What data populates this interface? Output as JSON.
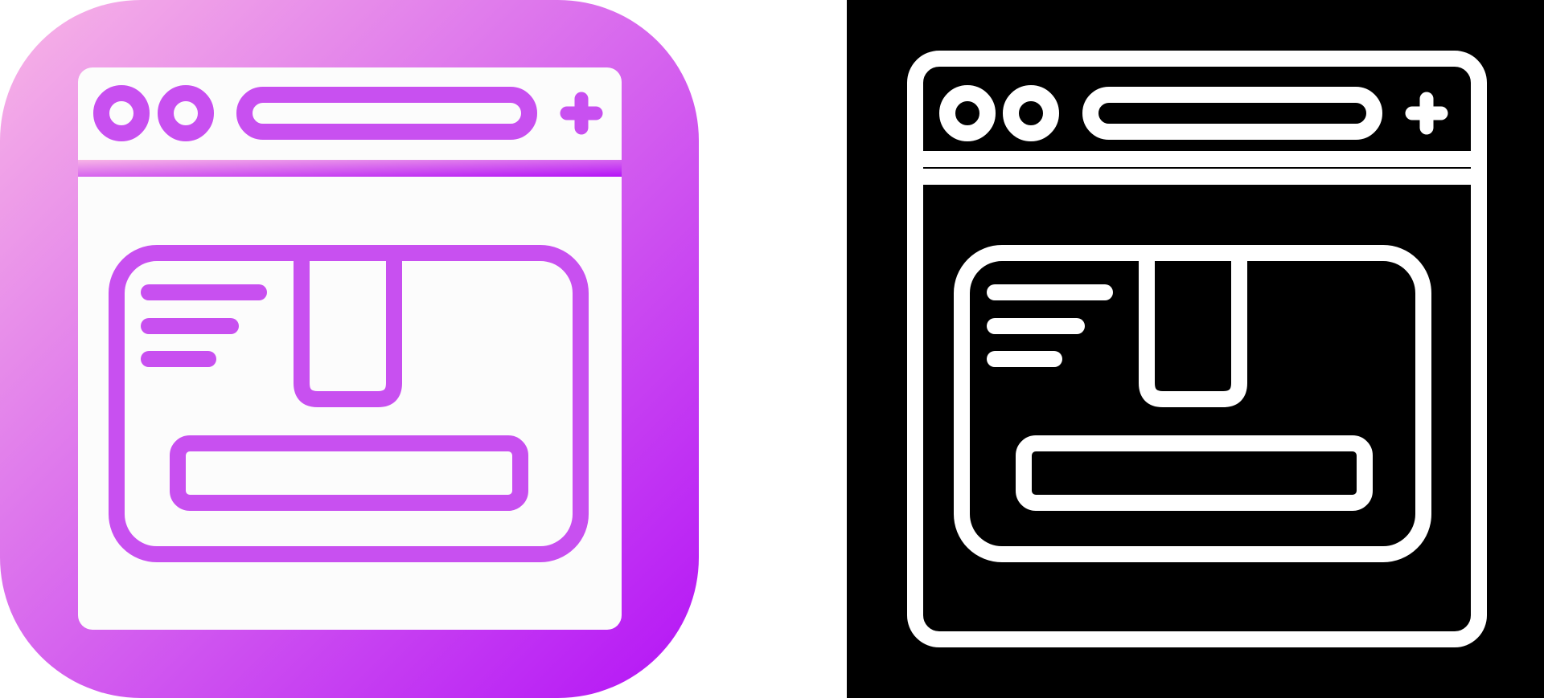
{
  "icons": [
    {
      "id": "gradient",
      "semantic": "web-package-delivery-icon",
      "variant": "gradient",
      "background_gradient": [
        "#f8b5e6",
        "#b414f6"
      ],
      "line_color": "#c850f0",
      "fill_color": "#fcfcfc"
    },
    {
      "id": "glyph",
      "semantic": "web-package-delivery-icon",
      "variant": "glyph",
      "background_color": "#000000",
      "line_color": "#ffffff"
    }
  ]
}
